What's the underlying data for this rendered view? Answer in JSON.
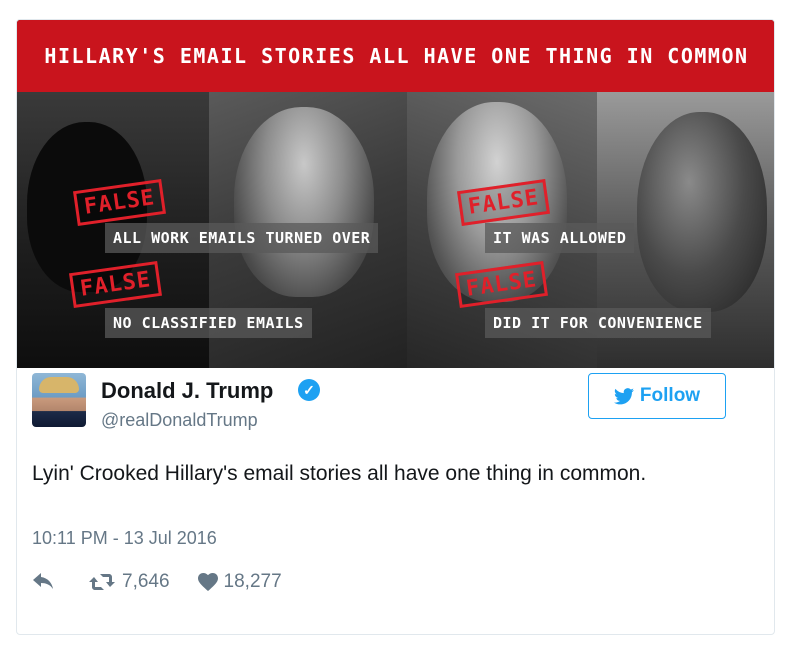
{
  "banner": {
    "title": "HILLARY'S EMAIL STORIES ALL HAVE ONE THING IN COMMON"
  },
  "claims": [
    {
      "stamp": "FALSE",
      "caption": "ALL WORK EMAILS TURNED OVER"
    },
    {
      "stamp": "FALSE",
      "caption": "IT WAS ALLOWED"
    },
    {
      "stamp": "FALSE",
      "caption": "NO CLASSIFIED EMAILS"
    },
    {
      "stamp": "FALSE",
      "caption": "DID IT FOR CONVENIENCE"
    }
  ],
  "author": {
    "name": "Donald J. Trump",
    "handle": "@realDonaldTrump",
    "verified": true
  },
  "follow_button": {
    "label": "Follow"
  },
  "tweet": {
    "text": "Lyin' Crooked Hillary's email stories all have one thing in common.",
    "timestamp": "10:11 PM - 13 Jul 2016"
  },
  "stats": {
    "retweets": "7,646",
    "likes": "18,277"
  },
  "icons": {
    "reply": "reply-icon",
    "retweet": "retweet-icon",
    "like": "heart-icon",
    "verified": "verified-badge-icon",
    "bird": "twitter-bird-icon"
  },
  "colors": {
    "banner": "#c9141d",
    "stamp": "#e0202a",
    "accent": "#1da1f2",
    "muted": "#657786"
  }
}
